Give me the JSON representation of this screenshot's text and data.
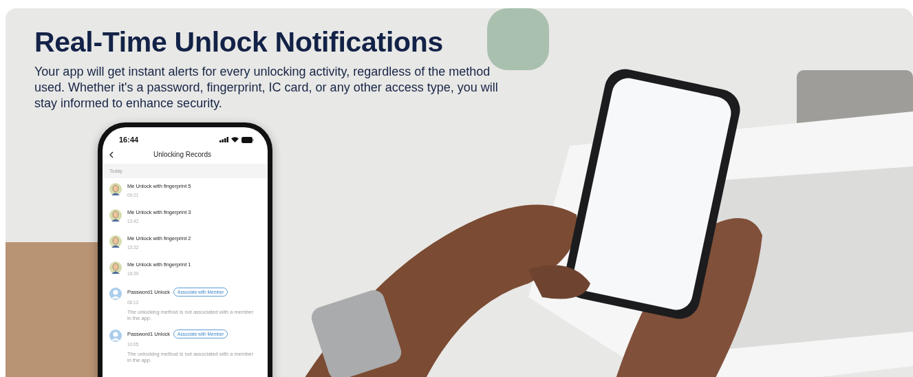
{
  "heading": "Real-Time Unlock Notifications",
  "description": "Your app will get instant alerts for every unlocking activity, regardless of the method used. Whether it's a password, fingerprint, IC card, or any other access type, you will stay informed to enhance security.",
  "phone": {
    "status_time": "16:44",
    "title": "Unlocking Records",
    "section": "Today",
    "records": [
      {
        "kind": "member",
        "text": "Me Unlock with fingerprint 5",
        "time": "09:21"
      },
      {
        "kind": "member",
        "text": "Me Unlock with fingerprint 3",
        "time": "13:42"
      },
      {
        "kind": "member",
        "text": "Me Unlock with fingerprint 2",
        "time": "15:32"
      },
      {
        "kind": "member",
        "text": "Me Unlock with fingerprint 1",
        "time": "18:30"
      },
      {
        "kind": "unassigned",
        "text": "Password1 Unlock",
        "action": "Associate with Member",
        "time": "08:12",
        "note": "The unlocking method is not associated with a member in the app."
      },
      {
        "kind": "unassigned",
        "text": "Password1 Unlock",
        "action": "Associate with Member",
        "time": "10:05",
        "note": "The unlocking method is not associated with a member in the app."
      }
    ]
  }
}
